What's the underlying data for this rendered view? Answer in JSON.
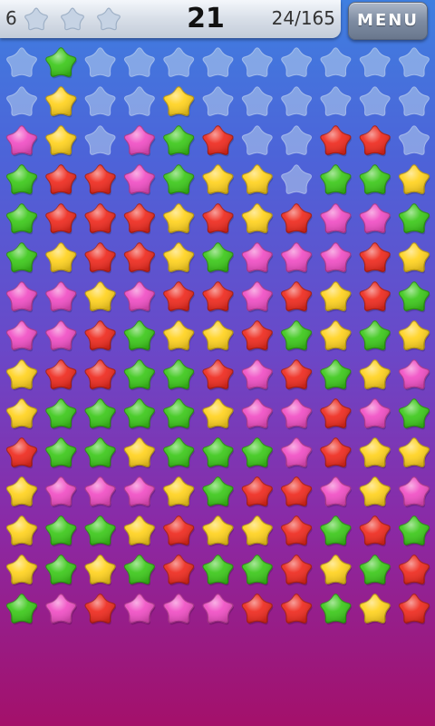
{
  "hud": {
    "level": "6",
    "rating_stars_earned": 0,
    "rating_stars_total": 3,
    "score": "21",
    "progress": "24/165",
    "menu_label": "MENU"
  },
  "colors": {
    "empty": "#b8d0ec",
    "green": "#3cc81a",
    "yellow": "#ffd21e",
    "red": "#ee2a1e",
    "pink": "#f04ec4"
  },
  "board": {
    "legend": {
      "E": "empty",
      "G": "green",
      "Y": "yellow",
      "R": "red",
      "P": "pink"
    },
    "rows": [
      "EGEEEEEEEEE",
      "EYEEYEEEEEE",
      "PYEPGREERRE",
      "GRRPGYYEGGY",
      "GRRRYRYRPPG",
      "GYRRYGPPPRY",
      "PPYPRRPRYRG",
      "PPRGYYRGYGY",
      "YRRGGRPRGYP",
      "YGGGGYPPRPG",
      "RGGYGGGPRYY",
      "YPPPYGRRPYP",
      "YGGYRYYRGRG",
      "YGYGRGGRYGR",
      "GPRPPPRRGYR"
    ]
  }
}
